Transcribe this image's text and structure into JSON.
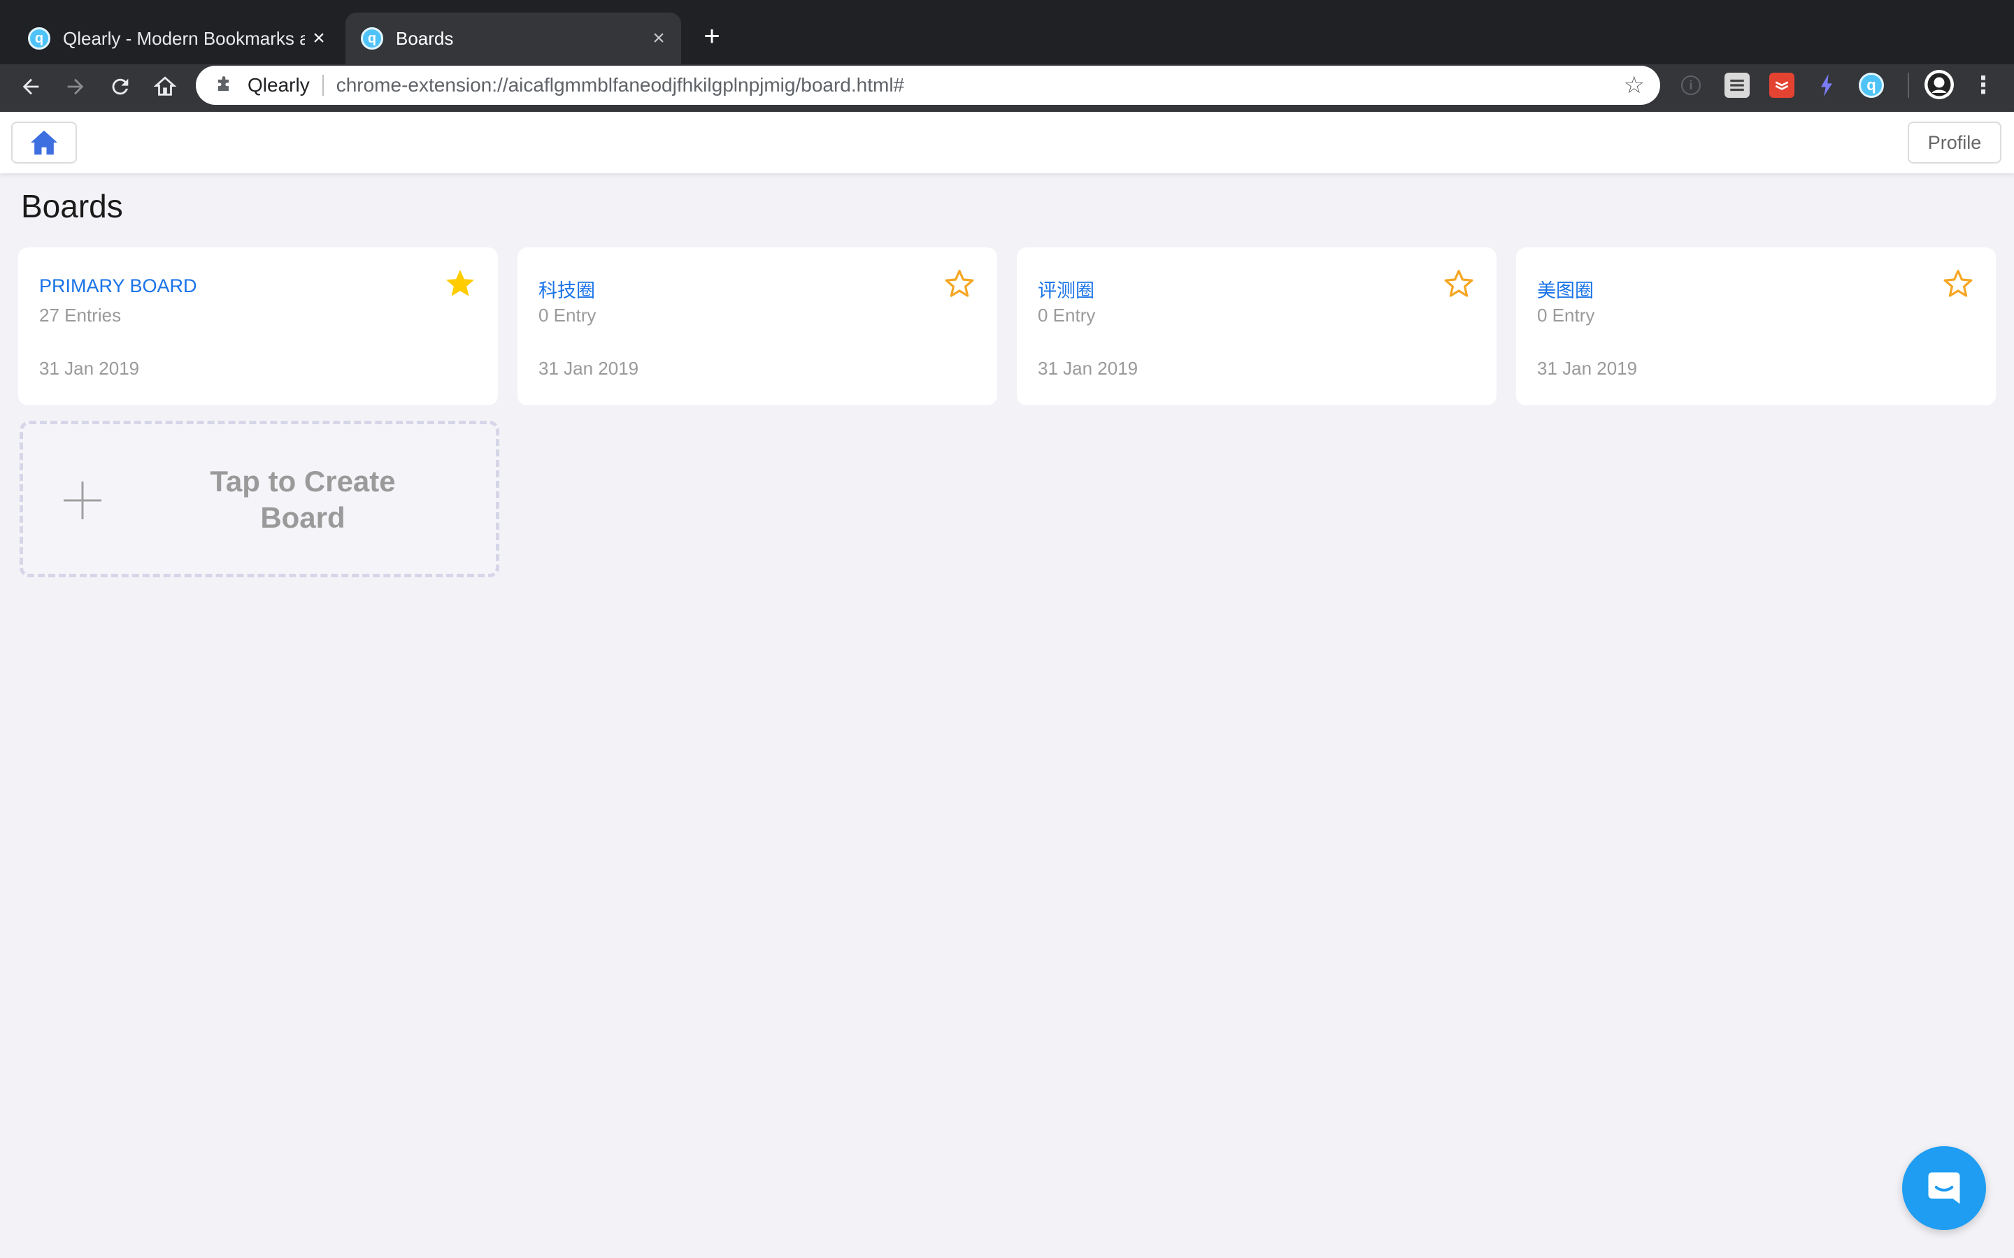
{
  "browser": {
    "tabs": [
      {
        "title": "Qlearly - Modern Bookmarks and",
        "active": false
      },
      {
        "title": "Boards",
        "active": true
      }
    ],
    "new_tab_label": "+",
    "omnibox": {
      "site_name": "Qlearly",
      "url": "chrome-extension://aicaflgmmblfaneodjfhkilgplnpjmig/board.html#"
    },
    "nav_icons": [
      "back-icon",
      "forward-icon",
      "reload-icon",
      "home-icon"
    ],
    "extension_icons": [
      "info-icon",
      "stack-icon",
      "todoist-icon",
      "bolt-icon",
      "qlearly-icon",
      "avatar",
      "menu-icon"
    ]
  },
  "app": {
    "header": {
      "home_icon": "house-icon",
      "profile_label": "Profile"
    },
    "page_title": "Boards",
    "boards": [
      {
        "name": "PRIMARY BOARD",
        "count": "27 Entries",
        "date": "31 Jan 2019",
        "favorite": true
      },
      {
        "name": "科技圈",
        "count": "0 Entry",
        "date": "31 Jan 2019",
        "favorite": false
      },
      {
        "name": "评测圈",
        "count": "0 Entry",
        "date": "31 Jan 2019",
        "favorite": false
      },
      {
        "name": "美图圈",
        "count": "0 Entry",
        "date": "31 Jan 2019",
        "favorite": false
      }
    ],
    "create_board_label": "Tap to Create Board"
  },
  "colors": {
    "accent": "#1a73e8",
    "star_filled": "#ffcc00",
    "star_outline": "#f5a623",
    "chat": "#1e9df2",
    "background": "#f2f2f7"
  }
}
